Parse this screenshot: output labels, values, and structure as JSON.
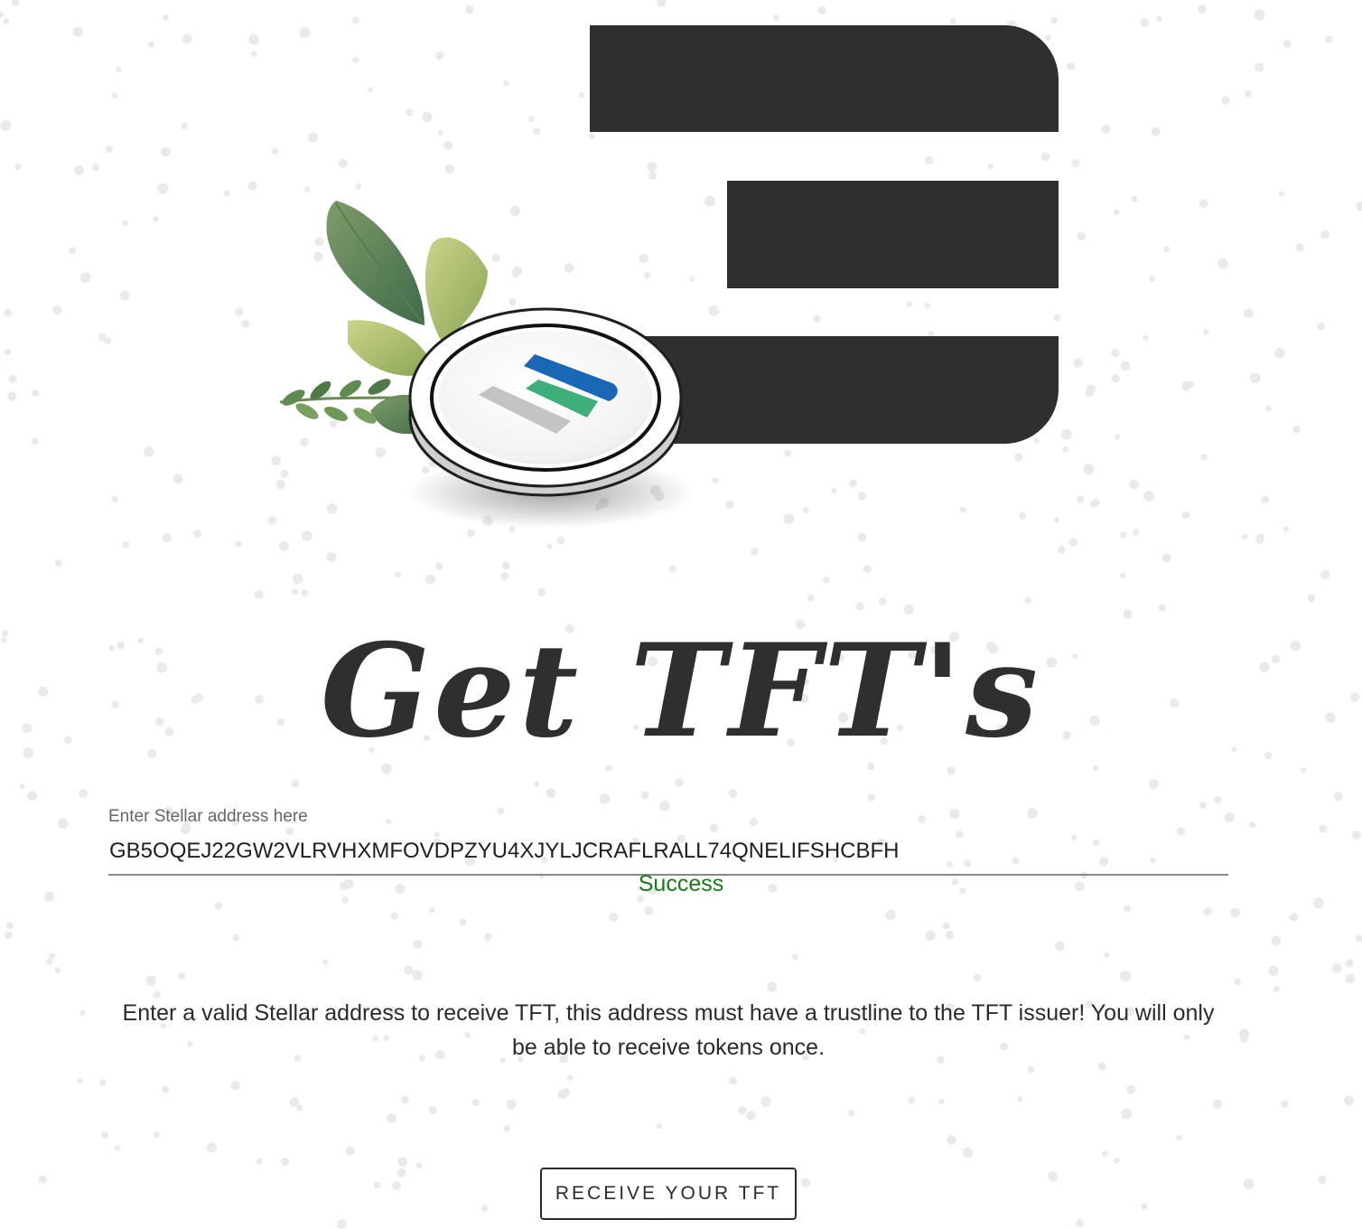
{
  "page": {
    "title": "Get TFT's"
  },
  "form": {
    "label": "Enter Stellar address here",
    "value": "GB5OQEJ22GW2VLRVHXMFOVDPZYU4XJYLJCRAFLRALL74QNELIFSHCBFH",
    "status": "Success",
    "status_color": "#1a7a1a"
  },
  "info": {
    "text": "Enter a valid Stellar address to receive TFT, this address must have a trustline to the TFT issuer! You will only be able to receive tokens once."
  },
  "actions": {
    "receive_label": "RECEIVE YOUR TFT"
  },
  "colors": {
    "brand_dark": "#2f2f2f",
    "logo_blue": "#1a67b5",
    "logo_green": "#3fae7a",
    "logo_gray": "#c4c4c4"
  }
}
